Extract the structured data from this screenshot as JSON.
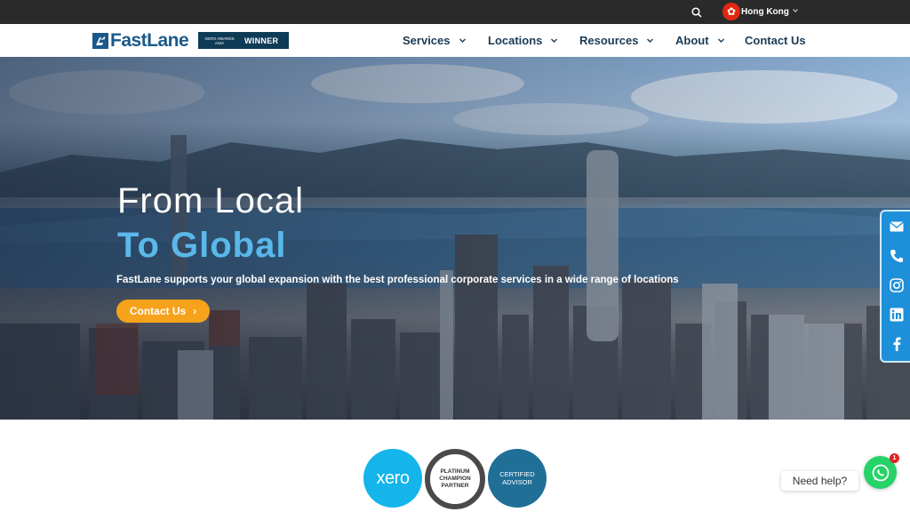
{
  "topbar": {
    "search_icon": "search-icon",
    "region": "Hong Kong",
    "flag_icon": "hong-kong-flag-icon"
  },
  "brand": {
    "logo_text": "FastLane",
    "award_left": "XERO AWARDS ASIA",
    "award_right": "WINNER",
    "colors": {
      "primary": "#1a5a8a",
      "accent": "#5ab8ea",
      "cta": "#f7a21b"
    }
  },
  "nav": {
    "items": [
      {
        "label": "Services",
        "dropdown": true
      },
      {
        "label": "Locations",
        "dropdown": true
      },
      {
        "label": "Resources",
        "dropdown": true
      },
      {
        "label": "About",
        "dropdown": true
      },
      {
        "label": "Contact Us",
        "dropdown": false
      }
    ]
  },
  "hero": {
    "title_line1": "From Local",
    "title_line2": "To Global",
    "subtitle": "FastLane supports your global expansion with the best professional corporate services in a wide range of locations",
    "cta_label": "Contact Us",
    "cta_arrow": "›"
  },
  "social": {
    "items": [
      "email-icon",
      "phone-icon",
      "instagram-icon",
      "linkedin-icon",
      "facebook-icon"
    ]
  },
  "partners": {
    "xero": "xero",
    "platinum": "PLATINUM CHAMPION PARTNER",
    "certified": "CERTIFIED ADVISOR"
  },
  "chat": {
    "help_text": "Need help?",
    "badge_count": "1"
  }
}
